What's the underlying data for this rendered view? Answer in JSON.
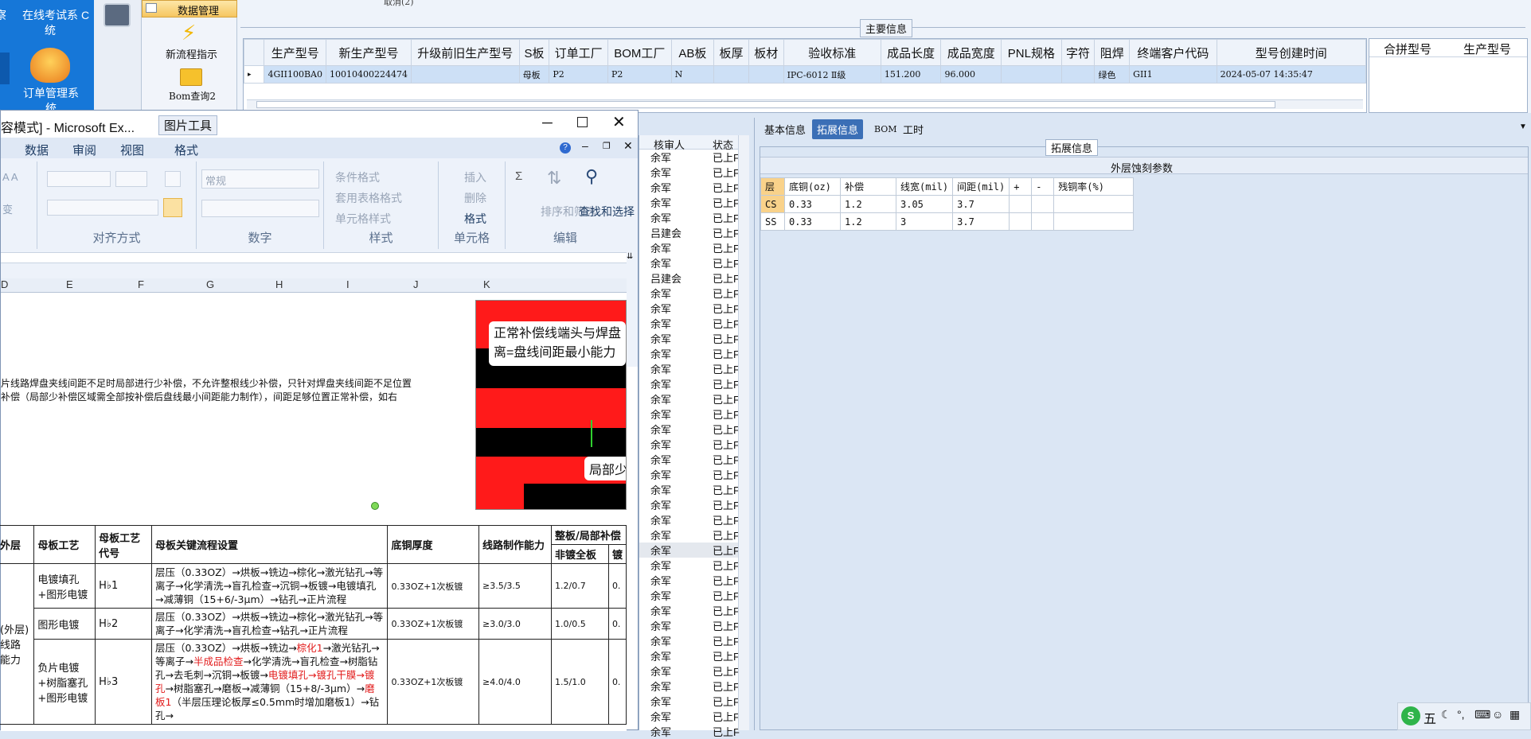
{
  "desktop": {
    "icons": [
      {
        "label": "在线考试系统"
      },
      {
        "label": "订单管理系统"
      }
    ],
    "edge_left": "察",
    "edge_right": "C"
  },
  "toolbar": {
    "data_mgmt": "数据管理",
    "new_flow": "新流程指示",
    "bom_query": "Bom查询2",
    "top_cut": "取消(2)"
  },
  "main_info": {
    "title": "主要信息",
    "columns": [
      "生产型号",
      "新生产型号",
      "升级前旧生产型号",
      "S板",
      "订单工厂",
      "BOM工厂",
      "AB板",
      "板厚",
      "板材",
      "验收标准",
      "成品长度",
      "成品宽度",
      "PNL规格",
      "字符",
      "阻焊",
      "终端客户代码",
      "型号创建时间"
    ],
    "row": [
      "4GII100BA0",
      "10010400224474",
      "",
      "母板",
      "P2",
      "P2",
      "N",
      "",
      "",
      "IPC-6012 Ⅱ级",
      "151.200",
      "96.000",
      "",
      "",
      "绿色",
      "GII1",
      "2024-05-07 14:35:47"
    ],
    "merge_columns": [
      "合拼型号",
      "生产型号"
    ]
  },
  "excel": {
    "title": "容模式] - Microsoft Ex...",
    "picture_tools": "图片工具",
    "tabs": [
      "数据",
      "审阅",
      "视图",
      "格式"
    ],
    "groups": {
      "align": "对齐方式",
      "number": "数字",
      "style": "样式",
      "cells": "单元格",
      "edit": "编辑"
    },
    "number_format": "常规",
    "cond_format": "条件格式",
    "table_format": "套用表格格式",
    "cell_style": "单元格样式",
    "insert": "插入",
    "delete": "删除",
    "format": "格式",
    "sort_filter": "排序和筛选",
    "find_select": "查找和选择",
    "col_headers": [
      "D",
      "E",
      "F",
      "G",
      "H",
      "I",
      "J",
      "K"
    ],
    "note_line1": "片线路焊盘夹线间距不足时局部进行少补偿，不允许整根线少补偿，只针对焊盘夹线间距不足位置",
    "note_line2": "补偿（局部少补偿区域需全部按补偿后盘线最小间距能力制作），间距足够位置正常补偿，如右",
    "pic_callout1a": "正常补偿线端头与焊盘",
    "pic_callout1b": "离=盘线间距最小能力",
    "pic_callout2": "局部少",
    "table_head": {
      "c0": "外层",
      "c1": "母板工艺",
      "c2": "母板工艺代号",
      "c3": "母板关键流程设置",
      "c4": "底铜厚度",
      "c5": "线路制作能力",
      "c6": "整板/局部补偿",
      "c6a": "非镀全板",
      "c7": "镀"
    },
    "side_label": "(外层)线路能力",
    "rows": [
      {
        "proc": "电镀填孔+图形电镀",
        "code": "H♭1",
        "flow": "层压（0.33OZ）→烘板→铣边→棕化→激光钻孔→等离子→化学清洗→盲孔检查→沉铜→板镀→电镀填孔→减薄铜（15+6/-3μm）→钻孔→正片流程",
        "cu": "0.33OZ+1次板镀",
        "cap": "≥3.5/3.5",
        "comp": "1.2/0.7",
        "last": "0."
      },
      {
        "proc": "图形电镀",
        "code": "H♭2",
        "flow": "层压（0.33OZ）→烘板→铣边→棕化→激光钻孔→等离子→化学清洗→盲孔检查→钻孔→正片流程",
        "cu": "0.33OZ+1次板镀",
        "cap": "≥3.0/3.0",
        "comp": "1.0/0.5",
        "last": "0."
      },
      {
        "proc": "负片电镀+树脂塞孔+图形电镀",
        "code": "H♭3",
        "flow_a": "层压（0.33OZ）→烘板→铣边→",
        "flow_r1": "棕化1",
        "flow_b": "→激光钻孔→等离子→",
        "flow_r2": "半成品检查",
        "flow_c": "→化学清洗→盲孔检查→树脂钻孔→去毛刺→沉铜→板镀→",
        "flow_r3": "电镀填孔→镀孔干膜→镀孔",
        "flow_d": "→树脂塞孔→磨板→减薄铜（15+8/-3μm）→",
        "flow_r4": "磨板1",
        "flow_e": "（半层压理论板厚≤0.5mm时增加磨板1）→钻孔→",
        "cu": "0.33OZ+1次板镀",
        "cap": "≥4.0/4.0",
        "comp": "1.5/1.0",
        "last": "0."
      }
    ]
  },
  "reviewer": {
    "header_name": "核审人",
    "header_status": "状态",
    "names": [
      "余军",
      "余军",
      "余军",
      "余军",
      "余军",
      "吕建会",
      "余军",
      "余军",
      "吕建会",
      "余军",
      "余军",
      "余军",
      "余军",
      "余军",
      "余军",
      "余军",
      "余军",
      "余军",
      "余军",
      "余军",
      "余军",
      "余军",
      "余军",
      "余军",
      "余军",
      "余军",
      "余军",
      "余军",
      "余军",
      "余军",
      "余军",
      "余军",
      "余军",
      "余军",
      "余军",
      "余军",
      "余军",
      "余军",
      "余军"
    ],
    "status": "已上F"
  },
  "panel": {
    "tabs": [
      "基本信息",
      "拓展信息",
      "BOM",
      "工时"
    ],
    "section": "拓展信息",
    "table_title": "外层蚀刻参数",
    "headers": [
      "层",
      "底铜(oz)",
      "补偿",
      "线宽(mil)",
      "间距(mil)",
      "+",
      "-",
      "残铜率(%)"
    ],
    "rows": [
      [
        "CS",
        "0.33",
        "1.2",
        "3.05",
        "3.7",
        "",
        "",
        ""
      ],
      [
        "SS",
        "0.33",
        "1.2",
        "3",
        "3.7",
        "",
        "",
        ""
      ]
    ]
  },
  "taskbar": {
    "ime_icon": "S",
    "ime_label": "五"
  }
}
